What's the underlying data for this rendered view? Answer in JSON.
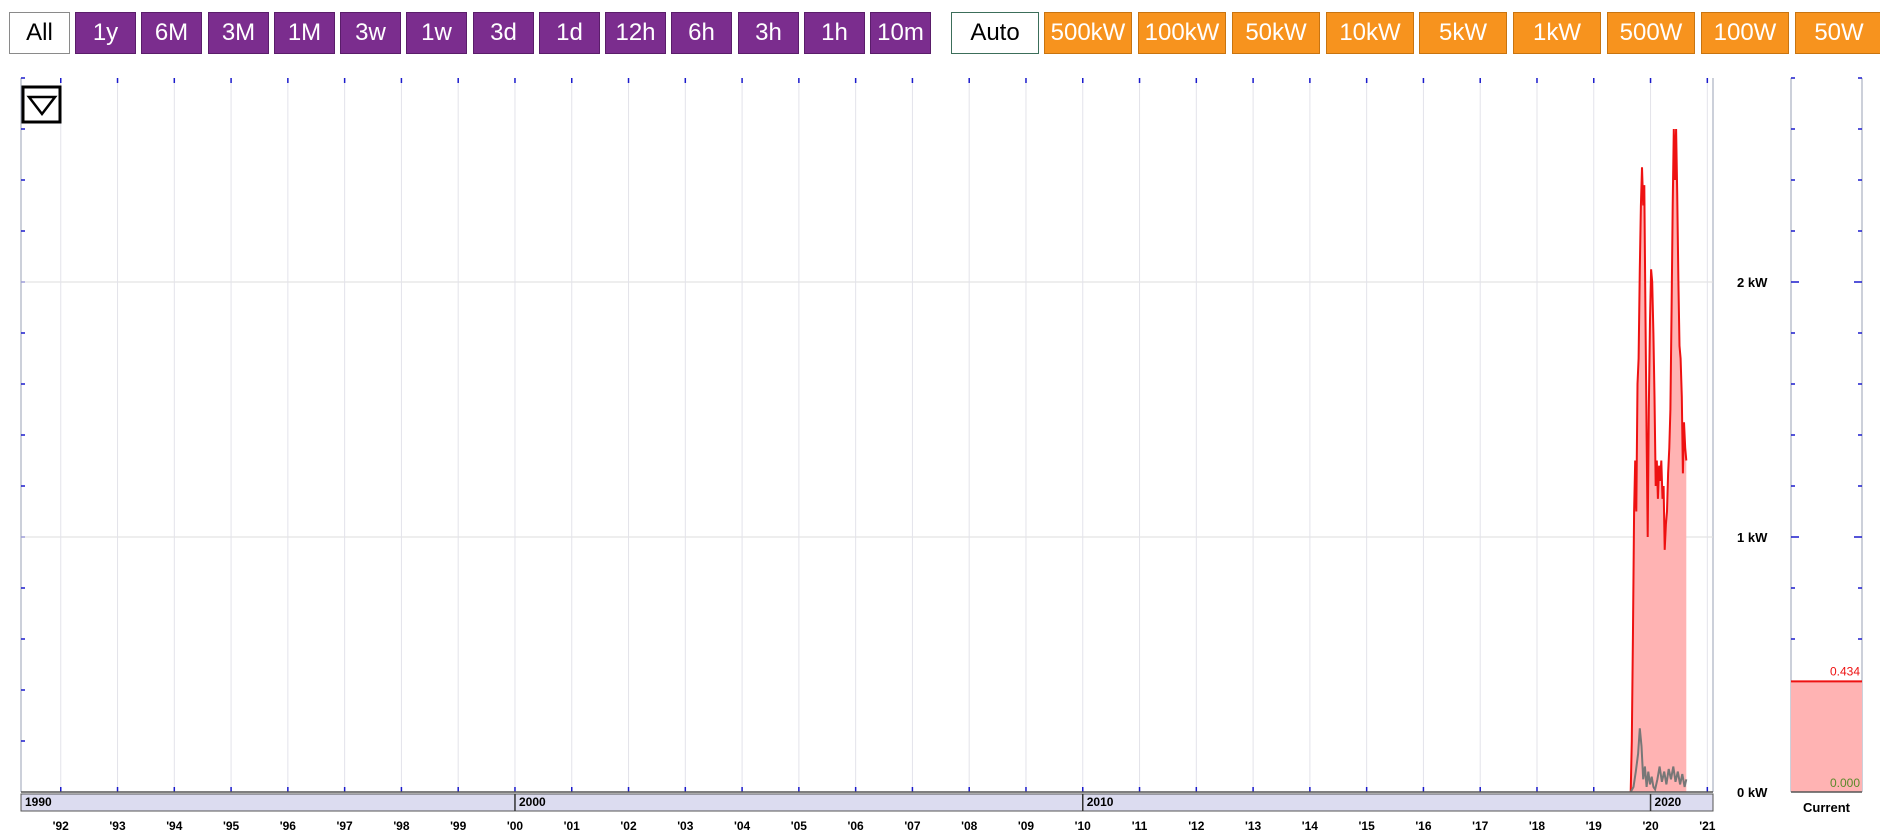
{
  "time_buttons": [
    {
      "label": "All",
      "style": "white"
    },
    {
      "label": "1y",
      "style": "purple"
    },
    {
      "label": "6M",
      "style": "purple"
    },
    {
      "label": "3M",
      "style": "purple"
    },
    {
      "label": "1M",
      "style": "purple"
    },
    {
      "label": "3w",
      "style": "purple"
    },
    {
      "label": "1w",
      "style": "purple"
    },
    {
      "label": "3d",
      "style": "purple"
    },
    {
      "label": "1d",
      "style": "purple"
    },
    {
      "label": "12h",
      "style": "purple"
    },
    {
      "label": "6h",
      "style": "purple"
    },
    {
      "label": "3h",
      "style": "purple"
    },
    {
      "label": "1h",
      "style": "purple"
    },
    {
      "label": "10m",
      "style": "purple"
    }
  ],
  "scale_buttons": [
    {
      "label": "Auto",
      "style": "white-green"
    },
    {
      "label": "500kW",
      "style": "orange"
    },
    {
      "label": "100kW",
      "style": "orange"
    },
    {
      "label": "50kW",
      "style": "orange"
    },
    {
      "label": "10kW",
      "style": "orange"
    },
    {
      "label": "5kW",
      "style": "orange"
    },
    {
      "label": "1kW",
      "style": "orange"
    },
    {
      "label": "500W",
      "style": "orange"
    },
    {
      "label": "100W",
      "style": "orange"
    },
    {
      "label": "50W",
      "style": "orange"
    }
  ],
  "colors": {
    "purple": "#7b2d8e",
    "orange": "#f7931e",
    "line": "#ee1111",
    "fill": "#ffb3b3",
    "secondary": "#777777",
    "current_zero": "#5a8a2a",
    "decade_band": "#dcdcf0",
    "tick_blue": "#1a1acc"
  },
  "chart_data": {
    "type": "area",
    "x_range": [
      1991.3,
      2021.1
    ],
    "ylim": [
      0,
      2.6
    ],
    "y_unit": "kW",
    "y_ticks": [
      {
        "value": 0,
        "label": "0 kW"
      },
      {
        "value": 1,
        "label": "1 kW"
      },
      {
        "value": 2,
        "label": "2 kW"
      }
    ],
    "grid": true,
    "year_ticks": [
      "'92",
      "'93",
      "'94",
      "'95",
      "'96",
      "'97",
      "'98",
      "'99",
      "'00",
      "'01",
      "'02",
      "'03",
      "'04",
      "'05",
      "'06",
      "'07",
      "'08",
      "'09",
      "'10",
      "'11",
      "'12",
      "'13",
      "'14",
      "'15",
      "'16",
      "'17",
      "'18",
      "'19",
      "'20",
      "'21"
    ],
    "decade_labels": [
      {
        "year": 1990,
        "label": "1990"
      },
      {
        "year": 2000,
        "label": "2000"
      },
      {
        "year": 2010,
        "label": "2010"
      },
      {
        "year": 2020,
        "label": "2020"
      }
    ],
    "series": [
      {
        "kind": "area",
        "color": "#ee1111",
        "points": [
          [
            2019.65,
            0
          ],
          [
            2019.67,
            0.2
          ],
          [
            2019.69,
            0.6
          ],
          [
            2019.71,
            1.1
          ],
          [
            2019.73,
            1.3
          ],
          [
            2019.75,
            1.1
          ],
          [
            2019.77,
            1.6
          ],
          [
            2019.79,
            1.7
          ],
          [
            2019.81,
            2.05
          ],
          [
            2019.83,
            2.3
          ],
          [
            2019.85,
            2.45
          ],
          [
            2019.87,
            2.3
          ],
          [
            2019.89,
            2.38
          ],
          [
            2019.91,
            1.9
          ],
          [
            2019.93,
            1.4
          ],
          [
            2019.95,
            1.0
          ],
          [
            2019.97,
            1.5
          ],
          [
            2019.99,
            1.85
          ],
          [
            2020.01,
            2.05
          ],
          [
            2020.03,
            2.0
          ],
          [
            2020.05,
            1.8
          ],
          [
            2020.07,
            1.55
          ],
          [
            2020.09,
            1.2
          ],
          [
            2020.11,
            1.3
          ],
          [
            2020.13,
            1.15
          ],
          [
            2020.15,
            1.28
          ],
          [
            2020.17,
            1.22
          ],
          [
            2020.19,
            1.3
          ],
          [
            2020.21,
            1.15
          ],
          [
            2020.23,
            1.2
          ],
          [
            2020.25,
            0.95
          ],
          [
            2020.27,
            1.05
          ],
          [
            2020.29,
            1.1
          ],
          [
            2020.31,
            1.25
          ],
          [
            2020.33,
            1.35
          ],
          [
            2020.35,
            1.5
          ],
          [
            2020.37,
            1.9
          ],
          [
            2020.39,
            2.3
          ],
          [
            2020.41,
            2.6
          ],
          [
            2020.43,
            2.4
          ],
          [
            2020.45,
            2.6
          ],
          [
            2020.47,
            2.35
          ],
          [
            2020.49,
            2.0
          ],
          [
            2020.51,
            1.75
          ],
          [
            2020.53,
            1.7
          ],
          [
            2020.55,
            1.55
          ],
          [
            2020.57,
            1.25
          ],
          [
            2020.59,
            1.45
          ],
          [
            2020.61,
            1.35
          ],
          [
            2020.63,
            1.3
          ]
        ]
      },
      {
        "kind": "line",
        "color": "#777777",
        "points": [
          [
            2019.65,
            0
          ],
          [
            2019.7,
            0.02
          ],
          [
            2019.74,
            0.08
          ],
          [
            2019.78,
            0.15
          ],
          [
            2019.81,
            0.25
          ],
          [
            2019.84,
            0.18
          ],
          [
            2019.87,
            0.05
          ],
          [
            2019.9,
            0.1
          ],
          [
            2019.93,
            0.02
          ],
          [
            2019.96,
            0.08
          ],
          [
            2019.99,
            0.03
          ],
          [
            2020.02,
            0.06
          ],
          [
            2020.05,
            0.02
          ],
          [
            2020.08,
            0.01
          ],
          [
            2020.12,
            0.05
          ],
          [
            2020.16,
            0.1
          ],
          [
            2020.2,
            0.04
          ],
          [
            2020.24,
            0.08
          ],
          [
            2020.28,
            0.03
          ],
          [
            2020.32,
            0.09
          ],
          [
            2020.36,
            0.05
          ],
          [
            2020.4,
            0.1
          ],
          [
            2020.44,
            0.04
          ],
          [
            2020.48,
            0.08
          ],
          [
            2020.52,
            0.03
          ],
          [
            2020.56,
            0.07
          ],
          [
            2020.6,
            0.02
          ],
          [
            2020.63,
            0.05
          ]
        ]
      }
    ],
    "current_panel": {
      "label": "Current",
      "main_value": "0.434",
      "secondary_value": "0.000"
    }
  }
}
